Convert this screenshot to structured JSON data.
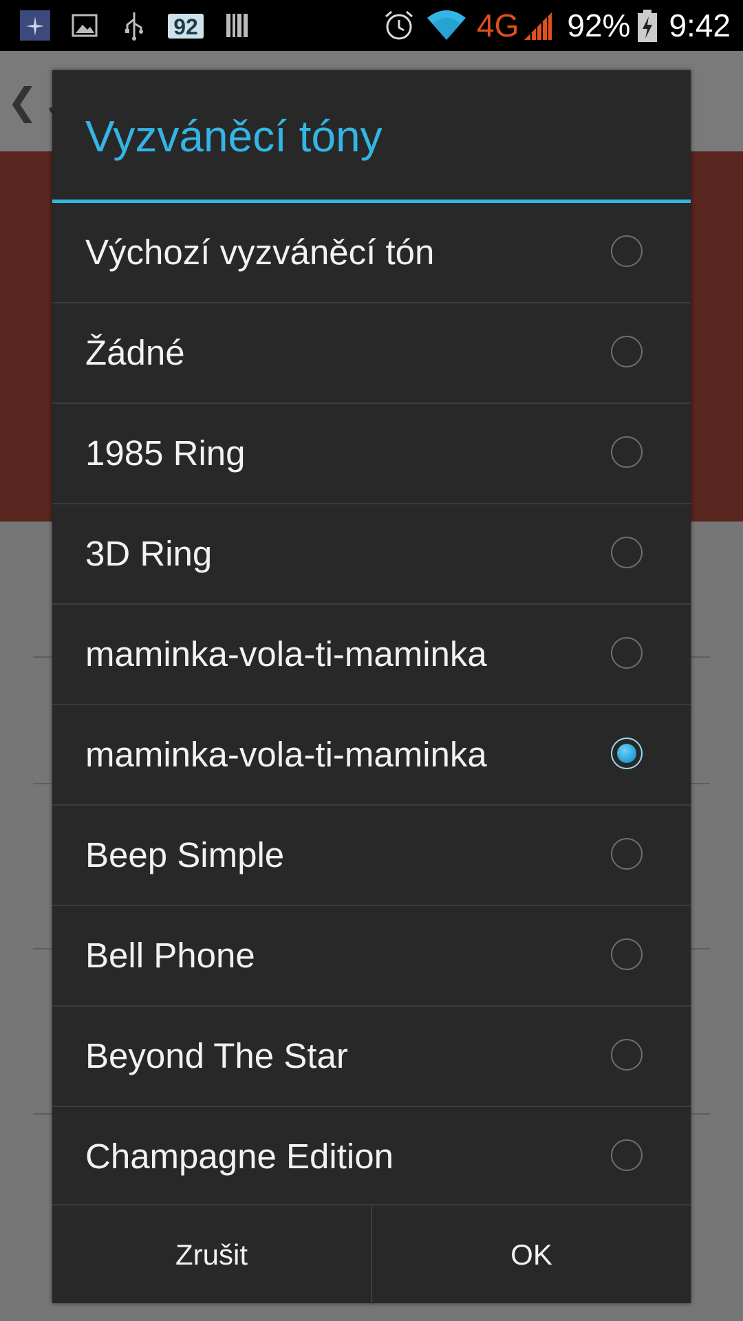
{
  "status_bar": {
    "notification_badge": "92",
    "network_type": "4G",
    "battery_percent": "92%",
    "time": "9:42",
    "icons": [
      "app-notification-icon",
      "image-icon",
      "usb-icon",
      "badge-92-icon",
      "barcode-icon",
      "alarm-icon",
      "wifi-icon",
      "signal-icon",
      "battery-charging-icon"
    ],
    "colors": {
      "network_type": "#e0501c"
    }
  },
  "background_app": {
    "back_label": "❮ J"
  },
  "dialog": {
    "title": "Vyzváněcí tóny",
    "accent_color": "#33b5e5",
    "options": [
      {
        "label": "Výchozí vyzváněcí tón",
        "selected": false
      },
      {
        "label": "Žádné",
        "selected": false
      },
      {
        "label": "1985 Ring",
        "selected": false
      },
      {
        "label": "3D Ring",
        "selected": false
      },
      {
        "label": "maminka-vola-ti-maminka",
        "selected": false
      },
      {
        "label": "maminka-vola-ti-maminka",
        "selected": true
      },
      {
        "label": "Beep Simple",
        "selected": false
      },
      {
        "label": "Bell Phone",
        "selected": false
      },
      {
        "label": "Beyond The Star",
        "selected": false
      },
      {
        "label": "Champagne Edition",
        "selected": false
      }
    ],
    "cancel_label": "Zrušit",
    "ok_label": "OK"
  }
}
